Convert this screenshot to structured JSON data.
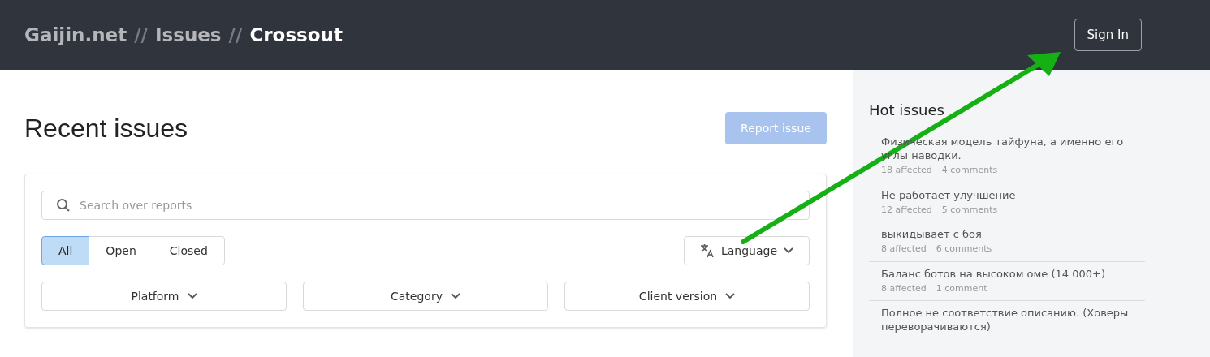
{
  "header": {
    "breadcrumbs": [
      {
        "label": "Gaijin.net",
        "current": false
      },
      {
        "label": "Issues",
        "current": false
      },
      {
        "label": "Crossout",
        "current": true
      }
    ],
    "separator": "//",
    "sign_in": "Sign In"
  },
  "main": {
    "title": "Recent issues",
    "report_button": "Report issue",
    "report_disabled": true,
    "search": {
      "placeholder": "Search over reports"
    },
    "status_tabs": [
      {
        "label": "All",
        "selected": true
      },
      {
        "label": "Open",
        "selected": false
      },
      {
        "label": "Closed",
        "selected": false
      }
    ],
    "language": "Language",
    "filters": [
      "Platform",
      "Category",
      "Client version"
    ]
  },
  "sidebar": {
    "title": "Hot issues",
    "items": [
      {
        "title": "Физическая модель тайфуна, а именно его углы наводки.",
        "affected": "18 affected",
        "comments": "4 comments"
      },
      {
        "title": "Не работает улучшение",
        "affected": "12 affected",
        "comments": "5 comments"
      },
      {
        "title": "выкидывает с боя",
        "affected": "8 affected",
        "comments": "6 comments"
      },
      {
        "title": "Баланс ботов на высоком оме (14 000+)",
        "affected": "8 affected",
        "comments": "1 comment"
      },
      {
        "title": "Полное не соответствие описанию. (Ховеры переворачиваются)"
      }
    ]
  }
}
